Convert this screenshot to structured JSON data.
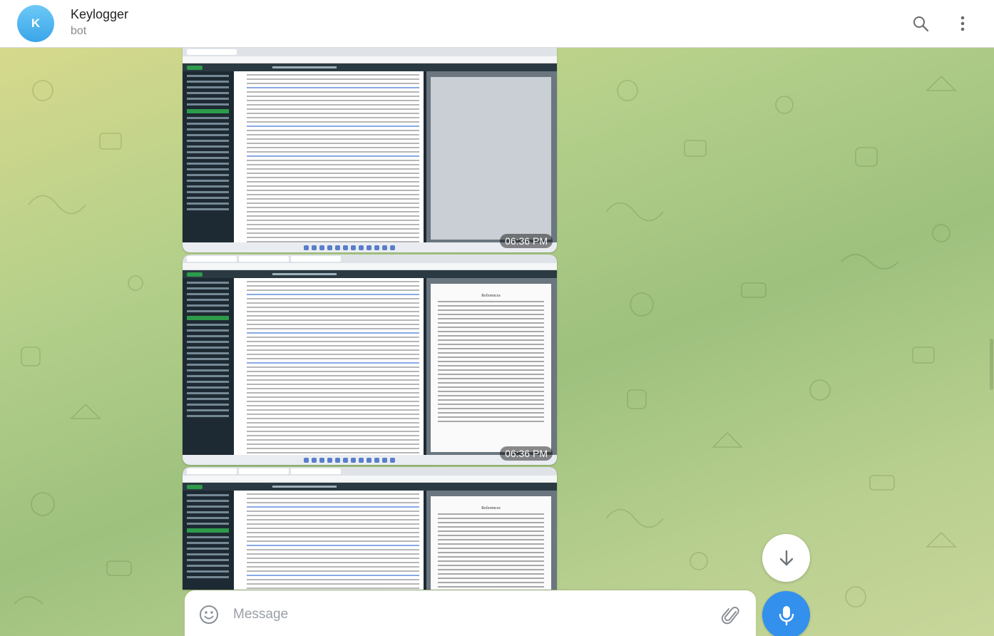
{
  "header": {
    "avatar_letter": "K",
    "title": "Keylogger",
    "subtitle": "bot",
    "icons": [
      "search-icon",
      "more-vertical-icon"
    ]
  },
  "messages": [
    {
      "kind": "screenshot",
      "pdf_panel": "blank-page",
      "time": "06:36 PM"
    },
    {
      "kind": "screenshot",
      "pdf_panel": "references-page",
      "pdf_title": "References",
      "time": "06:36 PM"
    },
    {
      "kind": "screenshot",
      "pdf_panel": "references-page",
      "pdf_title": "References",
      "time": ""
    }
  ],
  "composer": {
    "placeholder": "Message",
    "icons": [
      "emoji-icon",
      "paperclip-icon",
      "microphone-icon"
    ]
  },
  "scroll_button_icon": "arrow-down-icon",
  "colors": {
    "accent": "#3390ec",
    "avatar": "#3aa5e8"
  }
}
